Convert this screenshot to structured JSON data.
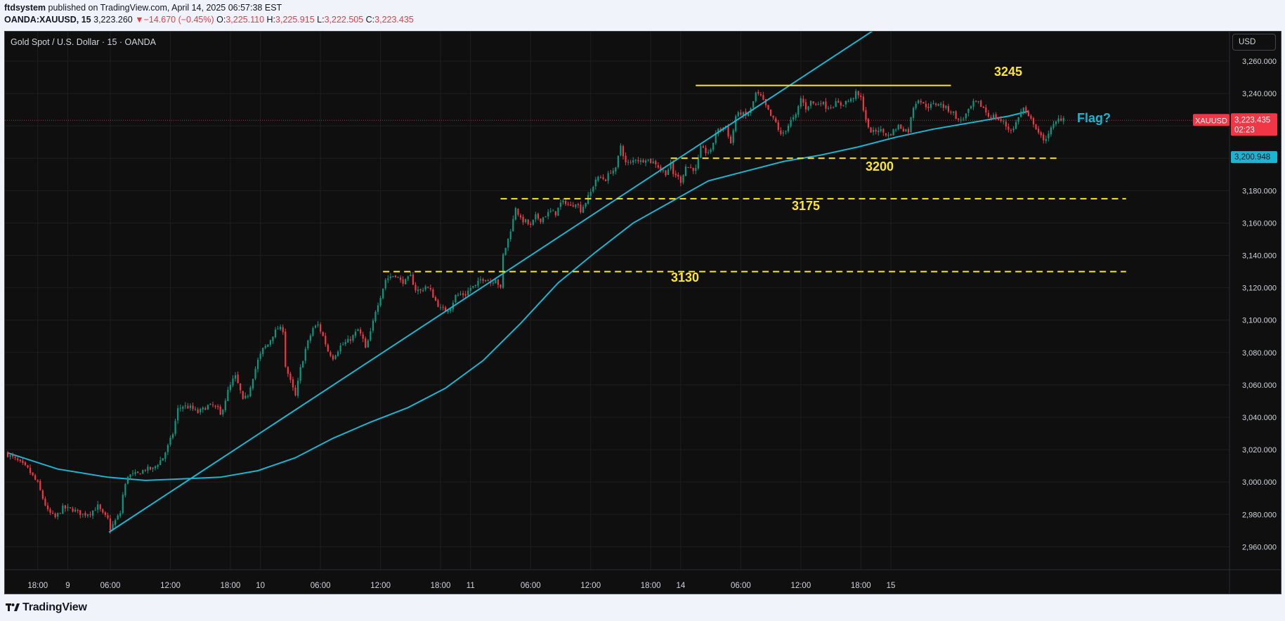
{
  "header": {
    "publisher_name": "ftdsystem",
    "published_text": "published on TradingView.com, April 14, 2025 06:57:38 EST",
    "symbol_interval": "OANDA:XAUUSD, 15",
    "last_price": "3,223.260",
    "change": "▼−14.670 (−0.45%)",
    "open_label": "O:",
    "open_value": "3,225.110",
    "high_label": "H:",
    "high_value": "3,225.915",
    "low_label": "L:",
    "low_value": "3,222.505",
    "close_label": "C:",
    "close_value": "3,223.435"
  },
  "chart_header": {
    "symbol_title": "Gold Spot / U.S. Dollar · 15 · OANDA",
    "currency_button": "USD"
  },
  "colors": {
    "background": "#0f0f0f",
    "grid": "#1e1e1e",
    "up_candle": "#089981",
    "down_candle": "#f23645",
    "trendline": "#18b6d2",
    "moving_average": "#18b6d2",
    "levels": "#fbe62b",
    "current_price_tag": "#f23645",
    "ma_price_tag": "#18b6d2"
  },
  "chart_data": {
    "type": "candlestick",
    "instrument": "XAUUSD",
    "timeframe": "15",
    "y_range": [
      2945,
      3282
    ],
    "grid": true,
    "y_ticks": [
      "2,960.000",
      "2,980.000",
      "3,000.000",
      "3,020.000",
      "3,040.000",
      "3,060.000",
      "3,080.000",
      "3,100.000",
      "3,120.000",
      "3,140.000",
      "3,160.000",
      "3,180.000",
      "3,200.000",
      "3,220.000",
      "3,240.000",
      "3,260.000"
    ],
    "y_tick_values": [
      2960,
      2980,
      3000,
      3020,
      3040,
      3060,
      3080,
      3100,
      3120,
      3140,
      3160,
      3180,
      3200,
      3220,
      3240,
      3260
    ],
    "x_ticks": [
      "18:00",
      "9",
      "06:00",
      "12:00",
      "18:00",
      "10",
      "06:00",
      "12:00",
      "18:00",
      "11",
      "06:00",
      "12:00",
      "18:00",
      "14",
      "06:00",
      "12:00",
      "18:00",
      "15"
    ],
    "x_tick_bar_index": [
      12,
      24,
      41,
      65,
      89,
      101,
      125,
      149,
      173,
      185,
      209,
      233,
      257,
      269,
      293,
      317,
      341,
      353
    ],
    "close_path": [
      [
        0,
        3017
      ],
      [
        4,
        3013
      ],
      [
        8,
        3008
      ],
      [
        12,
        2999
      ],
      [
        14,
        2990
      ],
      [
        16,
        2982
      ],
      [
        19,
        2978
      ],
      [
        22,
        2984
      ],
      [
        26,
        2983
      ],
      [
        30,
        2980
      ],
      [
        33,
        2981
      ],
      [
        36,
        2985
      ],
      [
        38,
        2980
      ],
      [
        40,
        2977
      ],
      [
        41,
        2971
      ],
      [
        45,
        2981
      ],
      [
        46,
        2992
      ],
      [
        48,
        3004
      ],
      [
        52,
        3005
      ],
      [
        55,
        3008
      ],
      [
        58,
        3008
      ],
      [
        62,
        3015
      ],
      [
        64,
        3022
      ],
      [
        66,
        3030
      ],
      [
        68,
        3045
      ],
      [
        70,
        3047
      ],
      [
        73,
        3046
      ],
      [
        76,
        3043
      ],
      [
        80,
        3047
      ],
      [
        82,
        3047
      ],
      [
        84,
        3045
      ],
      [
        85,
        3041
      ],
      [
        88,
        3056
      ],
      [
        90,
        3063
      ],
      [
        91,
        3065
      ],
      [
        93,
        3056
      ],
      [
        94,
        3050
      ],
      [
        96,
        3054
      ],
      [
        98,
        3065
      ],
      [
        100,
        3075
      ],
      [
        102,
        3082
      ],
      [
        104,
        3085
      ],
      [
        106,
        3091
      ],
      [
        108,
        3095
      ],
      [
        110,
        3094
      ],
      [
        111,
        3072
      ],
      [
        113,
        3062
      ],
      [
        115,
        3053
      ],
      [
        117,
        3070
      ],
      [
        119,
        3082
      ],
      [
        122,
        3095
      ],
      [
        124,
        3097
      ],
      [
        126,
        3090
      ],
      [
        128,
        3081
      ],
      [
        130,
        3077
      ],
      [
        133,
        3084
      ],
      [
        136,
        3087
      ],
      [
        138,
        3090
      ],
      [
        140,
        3094
      ],
      [
        142,
        3088
      ],
      [
        143,
        3082
      ],
      [
        145,
        3092
      ],
      [
        147,
        3106
      ],
      [
        149,
        3115
      ],
      [
        151,
        3125
      ],
      [
        153,
        3127
      ],
      [
        155,
        3128
      ],
      [
        157,
        3124
      ],
      [
        159,
        3124
      ],
      [
        161,
        3127
      ],
      [
        163,
        3119
      ],
      [
        165,
        3118
      ],
      [
        167,
        3121
      ],
      [
        169,
        3118
      ],
      [
        171,
        3112
      ],
      [
        173,
        3107
      ],
      [
        175,
        3106
      ],
      [
        177,
        3108
      ],
      [
        179,
        3115
      ],
      [
        181,
        3116
      ],
      [
        183,
        3116
      ],
      [
        185,
        3120
      ],
      [
        187,
        3121
      ],
      [
        189,
        3125
      ],
      [
        191,
        3126
      ],
      [
        193,
        3123
      ],
      [
        195,
        3126
      ],
      [
        197,
        3119
      ],
      [
        198,
        3140
      ],
      [
        200,
        3150
      ],
      [
        202,
        3162
      ],
      [
        203,
        3170
      ],
      [
        205,
        3162
      ],
      [
        207,
        3161
      ],
      [
        209,
        3158
      ],
      [
        211,
        3164
      ],
      [
        213,
        3162
      ],
      [
        215,
        3165
      ],
      [
        217,
        3167
      ],
      [
        219,
        3166
      ],
      [
        221,
        3172
      ],
      [
        223,
        3173
      ],
      [
        225,
        3170
      ],
      [
        227,
        3173
      ],
      [
        229,
        3168
      ],
      [
        231,
        3173
      ],
      [
        233,
        3179
      ],
      [
        235,
        3187
      ],
      [
        237,
        3188
      ],
      [
        239,
        3187
      ],
      [
        241,
        3192
      ],
      [
        243,
        3193
      ],
      [
        245,
        3208
      ],
      [
        247,
        3197
      ],
      [
        249,
        3197
      ],
      [
        251,
        3200
      ],
      [
        253,
        3198
      ],
      [
        255,
        3200
      ],
      [
        257,
        3198
      ],
      [
        259,
        3197
      ],
      [
        261,
        3193
      ],
      [
        263,
        3191
      ],
      [
        265,
        3196
      ],
      [
        266,
        3190
      ],
      [
        267,
        3190
      ],
      [
        269,
        3186
      ],
      [
        271,
        3195
      ],
      [
        273,
        3194
      ],
      [
        275,
        3193
      ],
      [
        277,
        3206
      ],
      [
        279,
        3204
      ],
      [
        281,
        3204
      ],
      [
        283,
        3216
      ],
      [
        285,
        3218
      ],
      [
        287,
        3220
      ],
      [
        289,
        3209
      ],
      [
        291,
        3226
      ],
      [
        293,
        3228
      ],
      [
        295,
        3226
      ],
      [
        297,
        3230
      ],
      [
        299,
        3240
      ],
      [
        301,
        3238
      ],
      [
        303,
        3232
      ],
      [
        305,
        3226
      ],
      [
        307,
        3222
      ],
      [
        309,
        3214
      ],
      [
        311,
        3218
      ],
      [
        313,
        3223
      ],
      [
        315,
        3226
      ],
      [
        317,
        3237
      ],
      [
        319,
        3231
      ],
      [
        321,
        3235
      ],
      [
        323,
        3233
      ],
      [
        325,
        3235
      ],
      [
        327,
        3232
      ],
      [
        329,
        3232
      ],
      [
        331,
        3234
      ],
      [
        333,
        3233
      ],
      [
        335,
        3235
      ],
      [
        337,
        3236
      ],
      [
        339,
        3240
      ],
      [
        341,
        3237
      ],
      [
        344,
        3218
      ],
      [
        346,
        3216
      ],
      [
        348,
        3218
      ],
      [
        350,
        3216
      ],
      [
        352,
        3214
      ],
      [
        354,
        3217
      ],
      [
        356,
        3220
      ],
      [
        358,
        3218
      ],
      [
        360,
        3217
      ],
      [
        362,
        3232
      ],
      [
        364,
        3237
      ],
      [
        366,
        3233
      ],
      [
        368,
        3232
      ],
      [
        370,
        3233
      ],
      [
        372,
        3234
      ],
      [
        374,
        3232
      ],
      [
        376,
        3230
      ],
      [
        378,
        3228
      ],
      [
        380,
        3223
      ],
      [
        382,
        3225
      ],
      [
        384,
        3229
      ],
      [
        386,
        3234
      ],
      [
        388,
        3234
      ],
      [
        390,
        3231
      ],
      [
        392,
        3226
      ],
      [
        394,
        3226
      ],
      [
        396,
        3224
      ],
      [
        398,
        3222
      ],
      [
        400,
        3218
      ],
      [
        402,
        3218
      ],
      [
        404,
        3226
      ],
      [
        406,
        3231
      ],
      [
        408,
        3225
      ],
      [
        410,
        3222
      ],
      [
        412,
        3216
      ],
      [
        414,
        3210
      ],
      [
        416,
        3216
      ],
      [
        418,
        3220
      ],
      [
        420,
        3224
      ],
      [
        422,
        3225
      ]
    ],
    "moving_average": [
      [
        0,
        3018
      ],
      [
        20,
        3008
      ],
      [
        40,
        3003
      ],
      [
        55,
        3001
      ],
      [
        70,
        3002
      ],
      [
        85,
        3003
      ],
      [
        100,
        3007
      ],
      [
        115,
        3015
      ],
      [
        130,
        3027
      ],
      [
        145,
        3037
      ],
      [
        160,
        3046
      ],
      [
        175,
        3058
      ],
      [
        190,
        3075
      ],
      [
        205,
        3098
      ],
      [
        220,
        3123
      ],
      [
        235,
        3142
      ],
      [
        250,
        3160
      ],
      [
        265,
        3173
      ],
      [
        280,
        3186
      ],
      [
        295,
        3192
      ],
      [
        310,
        3198
      ],
      [
        325,
        3202
      ],
      [
        340,
        3207
      ],
      [
        355,
        3213
      ],
      [
        370,
        3218
      ],
      [
        385,
        3222
      ],
      [
        400,
        3226
      ],
      [
        408,
        3229
      ]
    ],
    "trendlines": [
      {
        "from": [
          40.5,
          2969
        ],
        "to": [
          350,
          3283
        ]
      }
    ],
    "levels": [
      {
        "label": "3245",
        "value": 3245,
        "style": "solid",
        "from_bar": 275,
        "to_bar": 377
      },
      {
        "label": "3200",
        "value": 3200,
        "style": "dashed",
        "from_bar": 265,
        "to_bar": 420
      },
      {
        "label": "3175",
        "value": 3175,
        "style": "dashed",
        "from_bar": 197,
        "to_bar": 447
      },
      {
        "label": "3130",
        "value": 3130,
        "style": "dashed",
        "from_bar": 150,
        "to_bar": 447
      }
    ],
    "annotations": [
      {
        "text": "Flag?",
        "bar": 383,
        "value": 3222
      }
    ],
    "current_price_line": 3223.435,
    "price_labels": [
      {
        "symbol": "XAUUSD",
        "value": "3,223.435",
        "countdown": "02:23"
      },
      {
        "value": "3,200.948"
      }
    ]
  },
  "footer": {
    "logo_text": "TradingView"
  }
}
